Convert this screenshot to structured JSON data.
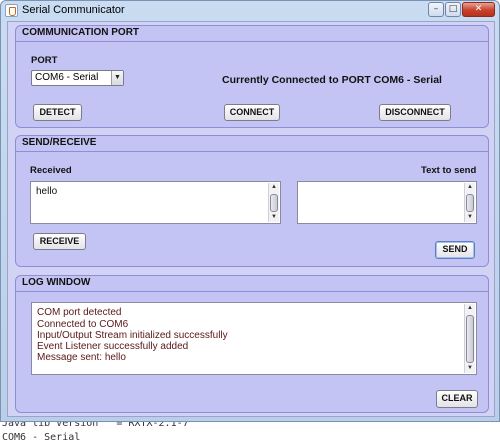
{
  "background_terminal": {
    "line1": "Java lib Version   = RXTX-2.1-7",
    "line2": "COM6 - Serial"
  },
  "window": {
    "title": "Serial Communicator",
    "controls": {
      "minimize": "–",
      "maximize": "□",
      "close": "✕"
    }
  },
  "communication_port": {
    "title": "COMMUNICATION PORT",
    "port_label": "PORT",
    "port_select": {
      "selected": "COM6 - Serial",
      "arrow": "▼"
    },
    "status_text": "Currently Connected to PORT COM6 - Serial",
    "buttons": {
      "detect": "DETECT",
      "connect": "CONNECT",
      "disconnect": "DISCONNECT"
    }
  },
  "send_receive": {
    "title": "SEND/RECEIVE",
    "received_label": "Received",
    "received_text": "hello",
    "send_label": "Text to send",
    "send_text": "",
    "buttons": {
      "receive": "RECEIVE",
      "send": "SEND"
    }
  },
  "log_window": {
    "title": "LOG WINDOW",
    "lines": [
      "COM port detected",
      "Connected to COM6",
      "Input/Output Stream initialized successfully",
      "Event Listener successfully added",
      "Message sent: hello"
    ],
    "buttons": {
      "clear": "CLEAR"
    }
  },
  "scroll_arrows": {
    "up": "▲",
    "down": "▼"
  },
  "colors": {
    "panel_background": "#c4c4f4",
    "panel_border": "#8d8fd6",
    "log_text": "#5a1818",
    "close_button": "#c9412b"
  },
  "icons": {
    "app": "coffee-cup-icon",
    "minimize": "minimize-icon",
    "maximize": "maximize-icon",
    "close": "close-icon"
  }
}
